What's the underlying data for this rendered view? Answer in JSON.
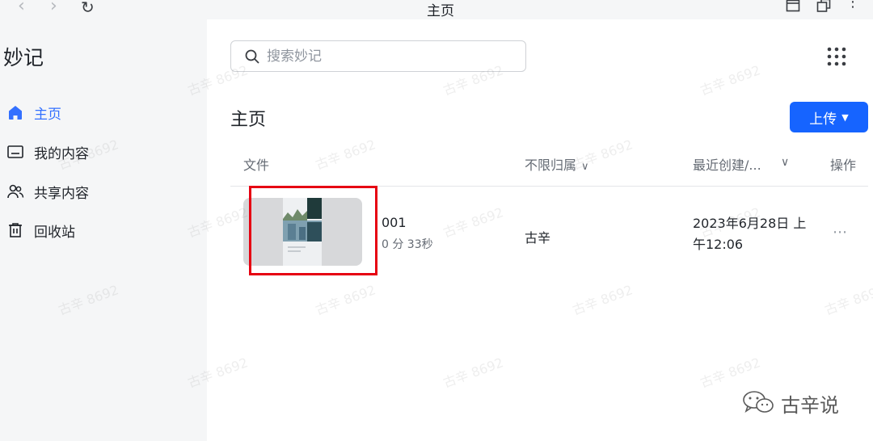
{
  "window": {
    "title": "主页"
  },
  "sidebar": {
    "app_title": "妙记",
    "items": [
      {
        "label": "主页",
        "icon": "home-icon",
        "active": true
      },
      {
        "label": "我的内容",
        "icon": "folder-icon",
        "active": false
      },
      {
        "label": "共享内容",
        "icon": "shared-users-icon",
        "active": false
      },
      {
        "label": "回收站",
        "icon": "trash-icon",
        "active": false
      }
    ]
  },
  "search": {
    "placeholder": "搜索妙记",
    "value": ""
  },
  "main": {
    "page_title": "主页",
    "upload_label": "上传"
  },
  "table": {
    "columns": {
      "file": "文件",
      "owner": "不限归属",
      "date": "最近创建/...",
      "ops": "操作"
    },
    "rows": [
      {
        "name": "001",
        "duration": "0 分 33秒",
        "owner": "古辛",
        "date": "2023年6月28日 上午12:06"
      }
    ]
  },
  "watermark": {
    "text": "古辛 8692"
  },
  "brand": {
    "text": "古辛说"
  },
  "colors": {
    "accent": "#3370ff",
    "primary_button": "#1664ff",
    "highlight_border": "#e60012",
    "sidebar_bg": "#f5f6f7"
  }
}
